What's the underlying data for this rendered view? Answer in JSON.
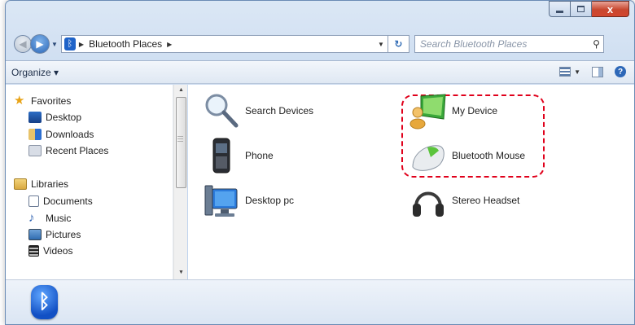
{
  "window": {
    "caption_buttons": {
      "minimize": "–",
      "maximize": "□",
      "close": "x"
    }
  },
  "address_bar": {
    "back_icon": "back-arrow-icon",
    "forward_icon": "forward-arrow-icon",
    "location_icon": "bluetooth-icon",
    "breadcrumb": [
      "Bluetooth Places"
    ],
    "refresh_icon": "refresh-icon"
  },
  "search": {
    "placeholder": "Search Bluetooth Places",
    "icon": "search-icon"
  },
  "toolbar": {
    "organize_label": "Organize",
    "icons": [
      "change-view-icon",
      "preview-pane-icon",
      "help-icon"
    ]
  },
  "nav_pane": {
    "favorites": {
      "label": "Favorites",
      "items": [
        "Desktop",
        "Downloads",
        "Recent Places"
      ]
    },
    "libraries": {
      "label": "Libraries",
      "items": [
        "Documents",
        "Music",
        "Pictures",
        "Videos"
      ]
    }
  },
  "content": {
    "items": [
      {
        "label": "Search Devices",
        "icon": "magnifier-icon"
      },
      {
        "label": "Phone",
        "icon": "phone-icon"
      },
      {
        "label": "Desktop pc",
        "icon": "computer-icon"
      },
      {
        "label": "My Device",
        "icon": "user-computer-icon"
      },
      {
        "label": "Bluetooth Mouse",
        "icon": "mouse-icon"
      },
      {
        "label": "Stereo Headset",
        "icon": "headset-icon"
      }
    ],
    "highlight_color": "#e0001b"
  },
  "details_pane": {
    "icon": "bluetooth-large-icon"
  },
  "colors": {
    "accent": "#1f63c8"
  }
}
